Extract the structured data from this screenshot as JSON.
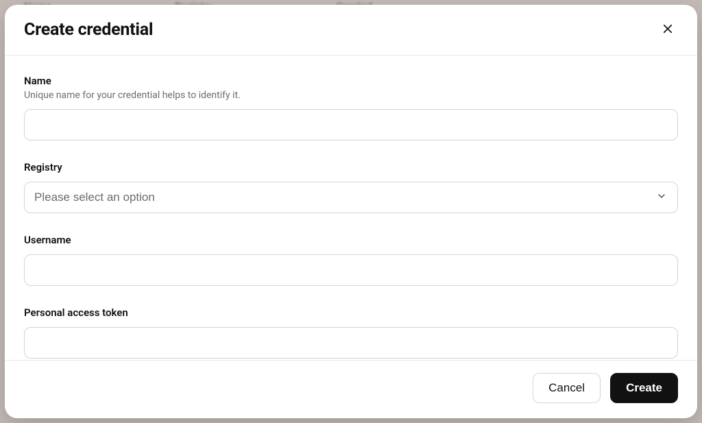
{
  "background_table": {
    "col_name": "Name",
    "col_registry": "Registry",
    "col_created": "Created"
  },
  "modal": {
    "title": "Create credential",
    "fields": {
      "name": {
        "label": "Name",
        "description": "Unique name for your credential helps to identify it.",
        "value": ""
      },
      "registry": {
        "label": "Registry",
        "placeholder": "Please select an option",
        "value": ""
      },
      "username": {
        "label": "Username",
        "value": ""
      },
      "token": {
        "label": "Personal access token",
        "value": ""
      }
    },
    "actions": {
      "cancel": "Cancel",
      "create": "Create"
    }
  }
}
